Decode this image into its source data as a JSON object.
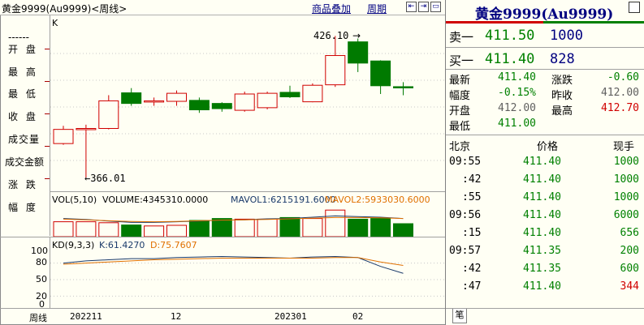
{
  "top": {
    "title": "黄金9999(Au9999)<周线>",
    "overlay_link": "商品叠加",
    "period_link": "周期"
  },
  "left_labels": [
    "------",
    "开  盘",
    "最  高",
    "最  低",
    "收  盘",
    "成交量",
    "成交金额",
    "涨  跌",
    "幅  度"
  ],
  "kline": {
    "indicator_label": "K",
    "high_annot": "426.10",
    "low_annot": "←366.01",
    "candles": [
      {
        "o": 380.5,
        "c": 386.5,
        "h": 388.0,
        "l": 380.0,
        "up": true
      },
      {
        "o": 386.5,
        "c": 386.9,
        "h": 388.5,
        "l": 366.01,
        "up": true
      },
      {
        "o": 386.9,
        "c": 398.6,
        "h": 401.0,
        "l": 386.5,
        "up": true
      },
      {
        "o": 402.0,
        "c": 397.5,
        "h": 404.0,
        "l": 396.5,
        "up": false
      },
      {
        "o": 398.3,
        "c": 398.6,
        "h": 400.0,
        "l": 396.5,
        "up": true
      },
      {
        "o": 398.4,
        "c": 401.8,
        "h": 403.0,
        "l": 396.5,
        "up": true
      },
      {
        "o": 398.8,
        "c": 394.8,
        "h": 400.0,
        "l": 393.5,
        "up": false
      },
      {
        "o": 397.5,
        "c": 395.3,
        "h": 398.0,
        "l": 394.0,
        "up": false
      },
      {
        "o": 394.6,
        "c": 401.5,
        "h": 402.5,
        "l": 394.0,
        "up": true
      },
      {
        "o": 395.7,
        "c": 401.8,
        "h": 402.5,
        "l": 395.0,
        "up": true
      },
      {
        "o": 402.2,
        "c": 400.3,
        "h": 405.0,
        "l": 399.8,
        "up": false
      },
      {
        "o": 398.2,
        "c": 405.2,
        "h": 406.0,
        "l": 398.0,
        "up": true
      },
      {
        "o": 405.4,
        "c": 417.8,
        "h": 426.1,
        "l": 404.5,
        "up": true
      },
      {
        "o": 423.6,
        "c": 414.6,
        "h": 425.0,
        "l": 410.8,
        "up": false
      },
      {
        "o": 415.5,
        "c": 405.0,
        "h": 415.8,
        "l": 401.5,
        "up": false
      },
      {
        "o": 404.6,
        "c": 404.1,
        "h": 406.5,
        "l": 401.0,
        "up": false
      }
    ]
  },
  "volume": {
    "label_main": "VOL(5,10)",
    "label_volume": "VOLUME:4345310.0000",
    "label_ma1": "MAVOL1:6215191.6000",
    "label_ma2": "MAVOL2:5933030.6000",
    "bars": [
      0.46,
      0.46,
      0.43,
      0.36,
      0.33,
      0.35,
      0.5,
      0.56,
      0.54,
      0.54,
      0.59,
      0.56,
      0.82,
      0.54,
      0.56,
      0.4
    ],
    "up": [
      true,
      true,
      true,
      false,
      true,
      true,
      false,
      false,
      true,
      true,
      false,
      true,
      true,
      false,
      false,
      false
    ],
    "ma1": [
      0.56,
      0.53,
      0.48,
      0.44,
      0.44,
      0.46,
      0.48,
      0.51,
      0.52,
      0.55,
      0.56,
      0.6,
      0.64,
      0.62,
      0.6,
      0.56
    ],
    "ma2": [
      0.54,
      0.52,
      0.49,
      0.47,
      0.46,
      0.47,
      0.49,
      0.51,
      0.52,
      0.53,
      0.55,
      0.57,
      0.59,
      0.59,
      0.58,
      0.56
    ]
  },
  "kd": {
    "label_main": "KD(9,3,3)",
    "label_k": "K:61.4270",
    "label_d": "D:75.7607",
    "axis_ticks": [
      "100",
      "80",
      "50",
      "20",
      "0"
    ],
    "k": [
      80,
      84,
      86,
      88,
      88,
      90,
      91,
      92,
      91,
      90,
      89,
      91,
      92,
      90,
      74,
      61.4
    ],
    "d": [
      78,
      80,
      82,
      84,
      86,
      87,
      88,
      89,
      89,
      89,
      89,
      89,
      90,
      90,
      82,
      75.8
    ]
  },
  "xaxis": {
    "corner_label": "周线",
    "labels": [
      "202211",
      "12",
      "202301",
      "02"
    ]
  },
  "quote": {
    "title": "黄金9999(Au9999)",
    "sell_label": "卖一",
    "sell_price": "411.50",
    "sell_vol": "1000",
    "buy_label": "买一",
    "buy_price": "411.40",
    "buy_vol": "828",
    "stats": [
      {
        "l1": "最新",
        "v1": "411.40",
        "c1": "g",
        "l2": "涨跌",
        "v2": "-0.60",
        "c2": "g"
      },
      {
        "l1": "幅度",
        "v1": "-0.15%",
        "c1": "g",
        "l2": "昨收",
        "v2": "412.00",
        "c2": "gray"
      },
      {
        "l1": "开盘",
        "v1": "412.00",
        "c1": "gray",
        "l2": "最高",
        "v2": "412.70",
        "c2": "r"
      },
      {
        "l1": "最低",
        "v1": "411.00",
        "c1": "g",
        "l2": "",
        "v2": "",
        "c2": "gray"
      }
    ]
  },
  "ticks": {
    "header_market": "北京",
    "header_price": "价格",
    "header_vol": "现手",
    "rows": [
      {
        "t": "09:55",
        "p": "411.40",
        "v": "1000",
        "vc": "g"
      },
      {
        "t": ":42",
        "p": "411.40",
        "v": "1000",
        "vc": "g"
      },
      {
        "t": ":55",
        "p": "411.40",
        "v": "1000",
        "vc": "g"
      },
      {
        "t": "09:56",
        "p": "411.40",
        "v": "6000",
        "vc": "g"
      },
      {
        "t": ":15",
        "p": "411.40",
        "v": "656",
        "vc": "g"
      },
      {
        "t": "09:57",
        "p": "411.35",
        "v": "200",
        "vc": "g"
      },
      {
        "t": ":42",
        "p": "411.35",
        "v": "600",
        "vc": "g"
      },
      {
        "t": ":47",
        "p": "411.40",
        "v": "344",
        "vc": "r"
      }
    ],
    "tab_label": "笔"
  },
  "colors": {
    "up": "#d00000",
    "down": "#007a00",
    "navy": "#000080",
    "ma1": "#1a3a6a",
    "ma2": "#e07000"
  }
}
